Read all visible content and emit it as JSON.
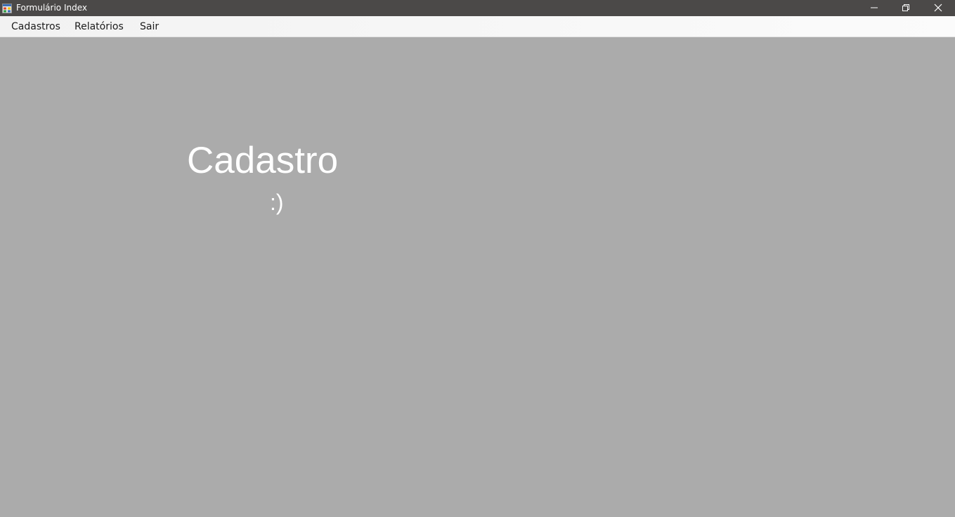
{
  "window": {
    "title": "Formulário Index",
    "controls": {
      "minimize_icon": "minimize-icon",
      "maximize_icon": "restore-icon",
      "close_icon": "close-icon"
    },
    "colors": {
      "titlebar": "#4b4948",
      "client_background": "#ababab",
      "menubar": "#f5f5f5",
      "text_white": "#ffffff"
    }
  },
  "menu": {
    "items": [
      {
        "label": "Cadastros"
      },
      {
        "label": "Relatórios"
      },
      {
        "label": "Sair"
      }
    ]
  },
  "main": {
    "heading": "Cadastro",
    "smiley": ":)"
  }
}
